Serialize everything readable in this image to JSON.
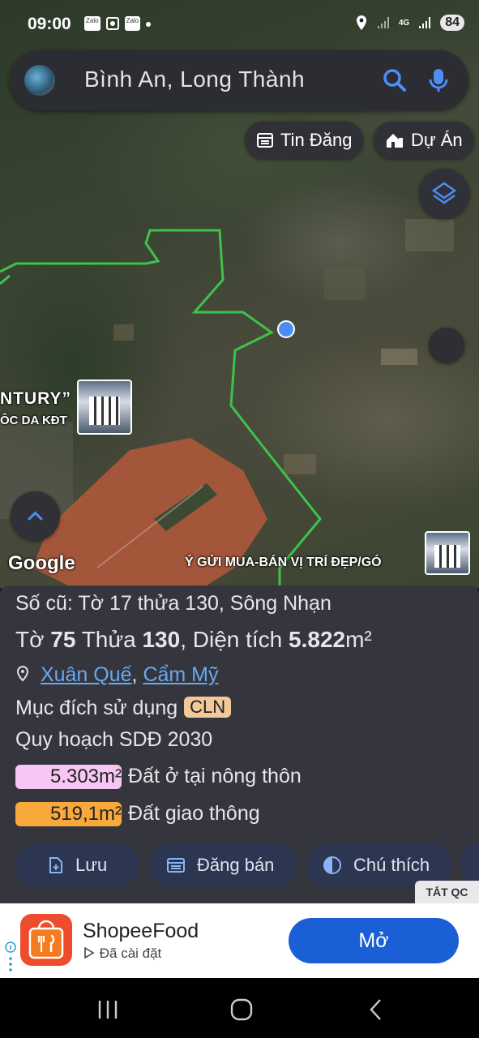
{
  "status": {
    "time": "09:00",
    "notif_icons": [
      "Zalo",
      "Zalo"
    ],
    "network": "4G",
    "battery": "84"
  },
  "search": {
    "query": "Bình An, Long Thành"
  },
  "chips": {
    "listings": "Tin Đăng",
    "projects": "Dự Án"
  },
  "map": {
    "label_century": "NTURY”",
    "label_kdt": "ÔC DA KĐT",
    "google": "Google",
    "ad_banner": "Ý GỬI MUA-BÁN VỊ TRÍ ĐẸP/GÓ"
  },
  "parcel": {
    "old_ref": "Số cũ: Tờ 17 thửa 130, Sông Nhạn",
    "sheet_label": "Tờ",
    "sheet": "75",
    "plot_label": "Thửa",
    "plot": "130",
    "area_label": ", Diện tích",
    "area": "5.822",
    "area_unit": "m²",
    "location_ward": "Xuân Quế",
    "location_commune": "Cẩm Mỹ",
    "use_label": "Mục đích sử dụng",
    "use_code": "CLN",
    "plan_label": "Quy hoạch SDĐ 2030",
    "zones": [
      {
        "area": "5.303m²",
        "name": "Đất ở tại nông thôn",
        "color": "#f7c6f2"
      },
      {
        "area": "519,1m²",
        "name": "Đất giao thông",
        "color": "#f7a93c"
      }
    ]
  },
  "actions": {
    "save": "Lưu",
    "post": "Đăng bán",
    "legend": "Chú thích"
  },
  "hide_ads": "TẮT QC",
  "ad": {
    "app": "ShopeeFood",
    "installed": "Đã cài đặt",
    "open": "Mở"
  }
}
